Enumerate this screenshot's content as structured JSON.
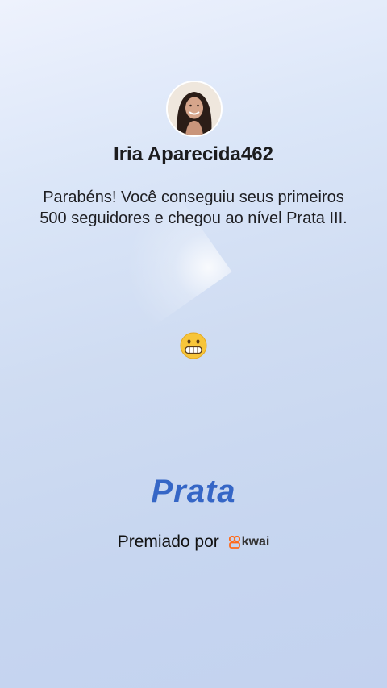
{
  "user": {
    "name": "Iria Aparecida462",
    "avatar_icon": "user-avatar-photo"
  },
  "message": "Parabéns! Você conseguiu seus primeiros 500 seguidores e chegou ao nível Prata III.",
  "emoji_icon": "grimacing-face-emoji",
  "level": {
    "label": "Prata",
    "color": "#3566c6"
  },
  "award": {
    "text": "Premiado por",
    "brand": "kwai",
    "brand_color": "#ff6a1a"
  }
}
